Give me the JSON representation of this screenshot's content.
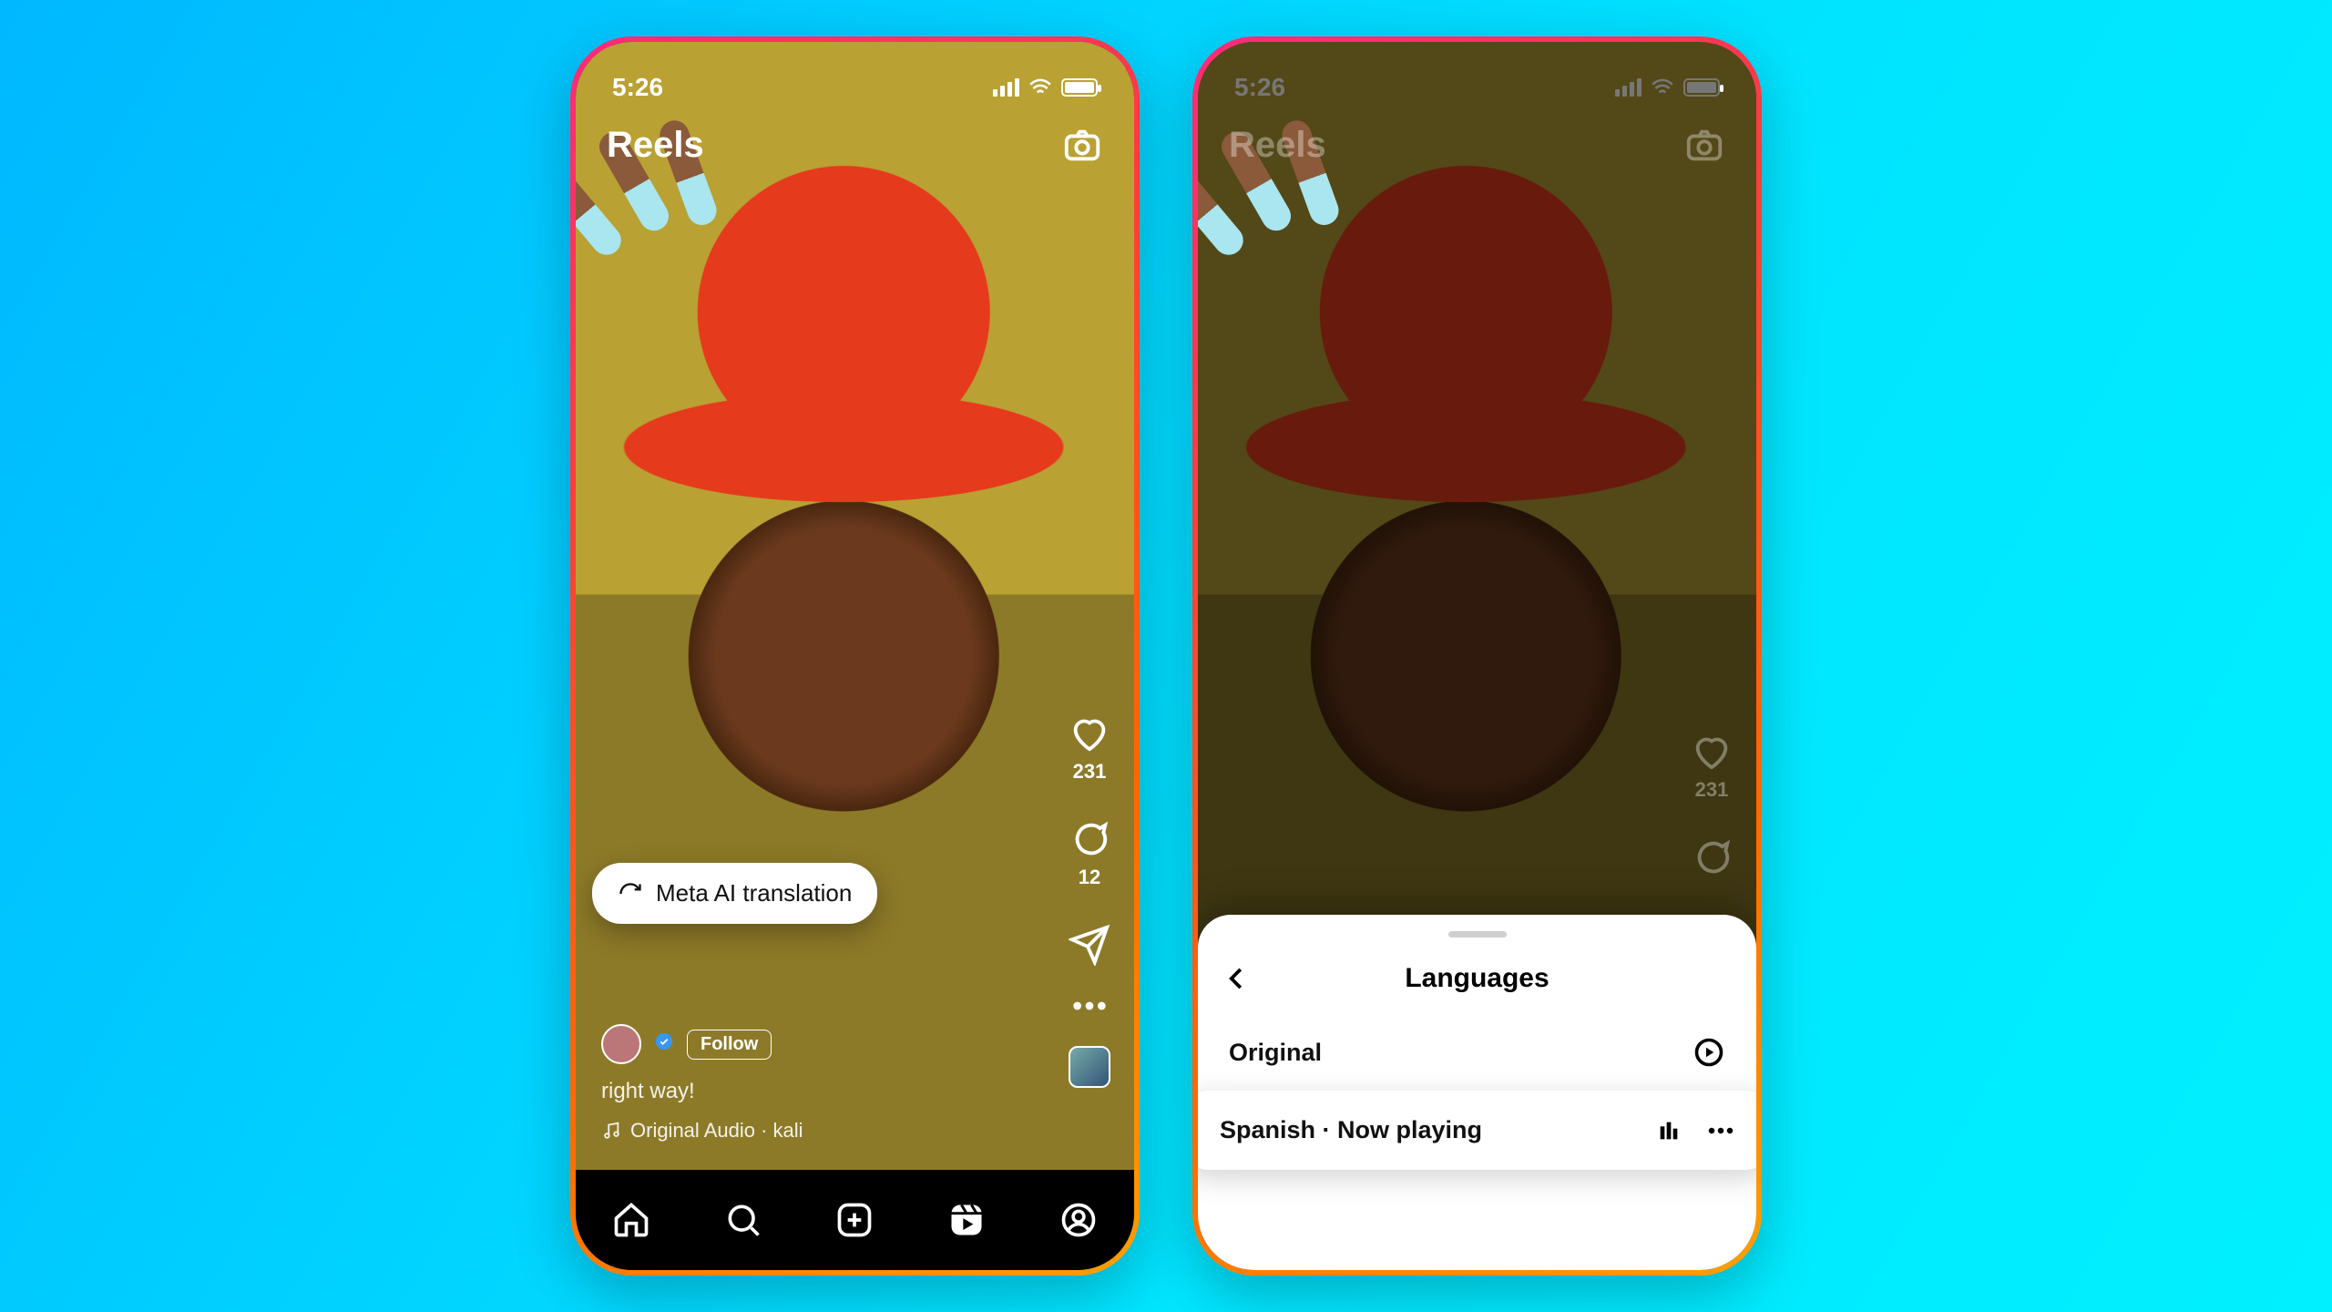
{
  "status": {
    "time": "5:26"
  },
  "header": {
    "title": "Reels"
  },
  "rail": {
    "likes": "231",
    "comments": "12"
  },
  "caption": {
    "line": "right way!",
    "audio": "Original Audio · kali"
  },
  "pill": {
    "label": "Meta AI translation"
  },
  "sheet": {
    "title": "Languages",
    "option_original": "Original",
    "option_active": "Spanish · Now playing"
  }
}
